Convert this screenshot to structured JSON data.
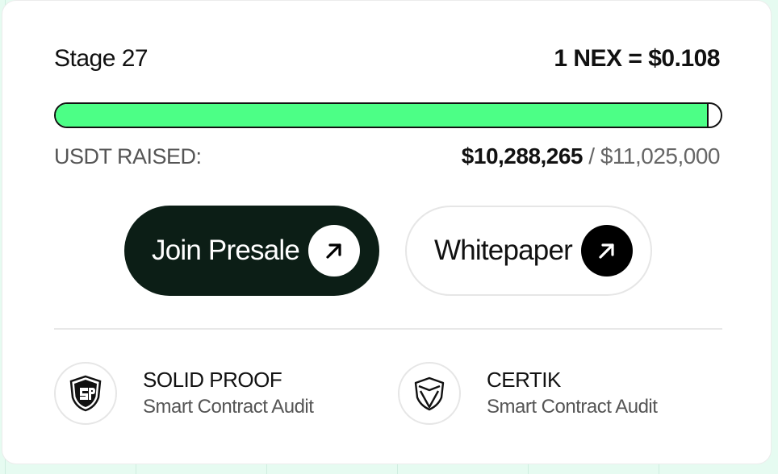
{
  "presale": {
    "stage": "Stage 27",
    "price": "1 NEX = $0.108",
    "progress_fraction": 0.9812,
    "raised_label": "USDT RAISED:",
    "raised_amount": "$10,288,265",
    "raised_separator": "/",
    "raised_goal": "$11,025,000"
  },
  "buttons": {
    "join_label": "Join Presale",
    "whitepaper_label": "Whitepaper"
  },
  "audits": [
    {
      "name": "SOLID PROOF",
      "subtitle": "Smart Contract Audit",
      "icon": "solidproof-shield-icon"
    },
    {
      "name": "CERTIK",
      "subtitle": "Smart Contract Audit",
      "icon": "certik-shield-icon"
    }
  ],
  "colors": {
    "progress_fill": "#4cff86",
    "join_button_bg": "#0c1e16",
    "page_bg": "#e6fbf1"
  }
}
